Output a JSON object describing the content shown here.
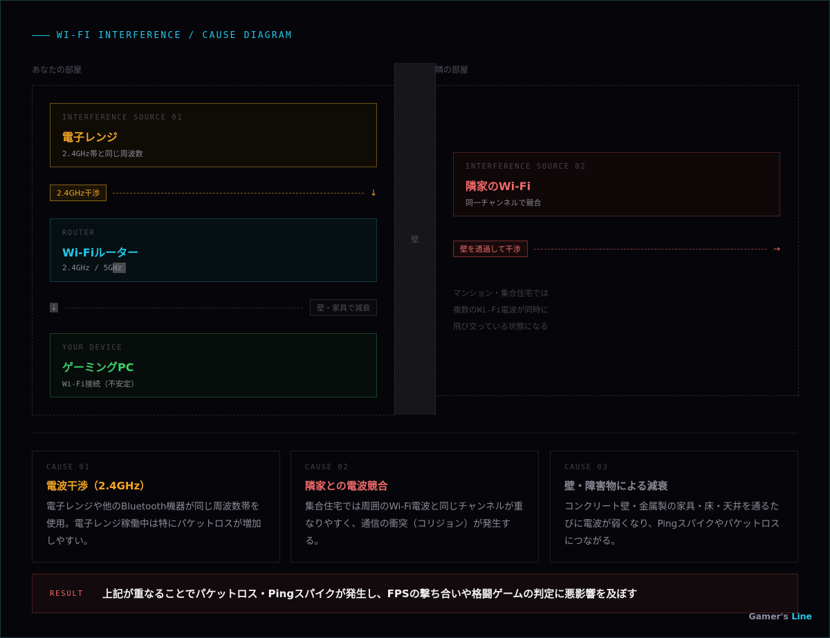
{
  "colors": {
    "accent": "#23c6e8",
    "microwave": "#f5a623",
    "neighbor": "#f06a6a",
    "router": "#23c6e8",
    "device": "#3ecf6e",
    "muted": "#8a8a96"
  },
  "header": {
    "title": "WI-FI INTERFERENCE / CAUSE DIAGRAM"
  },
  "rooms": {
    "yours": "あなたの部屋",
    "neighbor": "隣の部屋",
    "wall": "壁"
  },
  "nodes": {
    "microwave": {
      "kicker": "INTERFERENCE SOURCE 01",
      "title": "電子レンジ",
      "sub": "2.4GHz帯と同じ周波数"
    },
    "router": {
      "kicker": "ROUTER",
      "title": "Wi-Fiルーター",
      "sub_main": "2.4GHz / 5G",
      "sub_tail": "Hz"
    },
    "device": {
      "kicker": "YOUR DEVICE",
      "title": "ゲーミングPC",
      "sub": "Wi-Fi接続（不安定）"
    },
    "neighbor": {
      "kicker": "INTERFERENCE SOURCE 02",
      "title": "隣家のWi-Fi",
      "sub": "同一チャンネルで競合"
    }
  },
  "flows": {
    "interference_24": {
      "label": "2.4GHz干渉",
      "arrow": "↓"
    },
    "attenuation": {
      "label": "壁・家具で減衰",
      "arrow": "↓"
    },
    "through_wall": {
      "label": "壁を透過して干渉",
      "arrow": "→"
    }
  },
  "mansion_note": [
    "マンション・集合住宅では",
    "複数のWi-Fi電波が同時に",
    "飛び交っている状態になる"
  ],
  "causes": [
    {
      "kicker": "CAUSE 01",
      "title": "電波干渉（2.4GHz）",
      "body": "電子レンジや他のBluetooth機器が同じ周波数帯を使用。電子レンジ稼働中は特にパケットロスが増加しやすい。"
    },
    {
      "kicker": "CAUSE 02",
      "title": "隣家との電波競合",
      "body": "集合住宅では周囲のWi-Fi電波と同じチャンネルが重なりやすく、通信の衝突（コリジョン）が発生する。"
    },
    {
      "kicker": "CAUSE 03",
      "title": "壁・障害物による減衰",
      "body": "コンクリート壁・金属製の家具・床・天井を通るたびに電波が弱くなり、Pingスパイクやパケットロスにつながる。"
    }
  ],
  "result": {
    "kicker": "RESULT",
    "text": "上記が重なることでパケットロス・Pingスパイクが発生し、FPSの撃ち合いや格闘ゲームの判定に悪影響を及ぼす"
  },
  "brand": {
    "part1": "Gamer's",
    "part2": "Line"
  }
}
